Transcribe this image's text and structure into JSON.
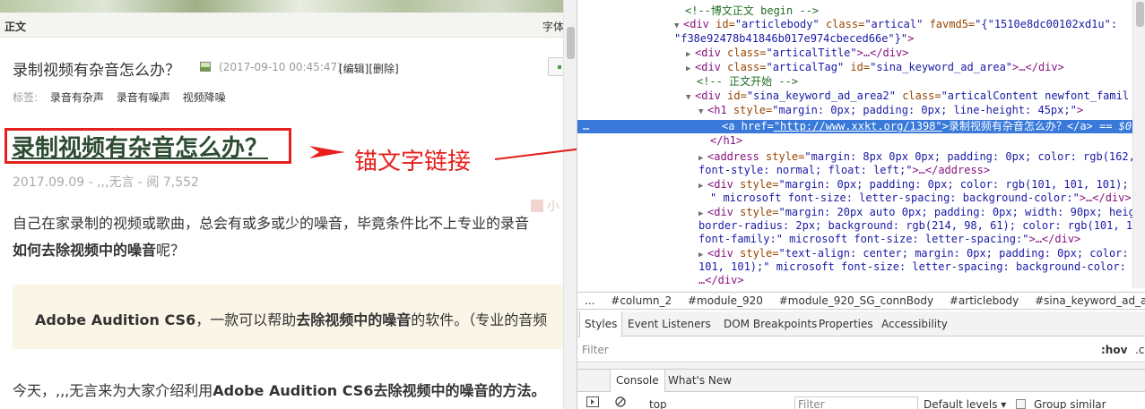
{
  "blog": {
    "section_title": "正文",
    "font_size_label": "字体",
    "post_title": "录制视频有杂音怎么办？",
    "post_date": "(2017-09-10 00:45:47)",
    "edit_links": "[编辑][删除]",
    "tags_label": "标签:",
    "tags": [
      "录音有杂声",
      "录音有噪声",
      "视频降噪"
    ],
    "article_title": "录制视频有杂音怎么办？",
    "annotation": "锚文字链接",
    "meta": "2017.09.09 - ,,,无言 - 阅 7,552",
    "watermark": "小小课堂",
    "para1_line1": "自己在家录制的视频或歌曲，总会有或多或少的噪音，毕竟条件比不上专业的录音",
    "para1_bold": "如何去除视频中的噪音",
    "para1_tail": "呢？",
    "quote_bold1": "Adobe Audition CS6",
    "quote_mid": "，一款可以帮助",
    "quote_bold2": "去除视频中的噪音",
    "quote_tail": "的软件。（专业的音频",
    "para2_start": "今天，,,,无言来为大家介绍利用",
    "para2_bold": "Adobe Audition CS6去除视频中的噪音的方法。"
  },
  "devtools": {
    "lines": [
      {
        "text": "<!--博文正文 begin -->"
      },
      {
        "tag_open": "<div",
        "a1": " id=",
        "v1": "\"articlebody\"",
        "a2": " class=",
        "v2": "\"artical\"",
        "a3": " favmd5=",
        "v3": "\"{\"1510e8dc00102xd1u\":"
      },
      {
        "v_cont": "\"f38e92478b41846b017e974cbeced66e\"}\"",
        "close": ">"
      },
      {
        "tag_open": "<div",
        "a1": " class=",
        "v1": "\"articalTitle\"",
        "rest": ">…</div>"
      },
      {
        "tag_open": "<div",
        "a1": " class=",
        "v1": "\"articalTag\"",
        "a2": " id=",
        "v2": "\"sina_keyword_ad_area\"",
        "rest": ">…</div>"
      },
      {
        "text": "<!-- 正文开始 -->"
      },
      {
        "tag_open": "<div",
        "a1": " id=",
        "v1": "\"sina_keyword_ad_area2\"",
        "a2": " class=",
        "v2": "\"articalContent   newfont_famil"
      },
      {
        "tag_open": "<h1",
        "a1": " style=",
        "v1": "\"margin: 0px; padding: 0px; line-height: 45px;\"",
        "rest": ">"
      },
      {
        "tag_open": "<a",
        "a1": " href=",
        "v1": "\"http://www.xxkt.org/1398\"",
        "inner": ">录制视频有杂音怎么办？</a>",
        "suffix": " == $0"
      },
      {
        "rest": "</h1>"
      },
      {
        "tag_open": "<address",
        "a1": " style=",
        "v1": "\"margin: 8px 0px 0px; padding: 0px; color: rgb(162,"
      },
      {
        "v_cont": "font-style: normal; float: left;\"",
        "rest": ">…</address>"
      },
      {
        "tag_open": "<div",
        "a1": " style=",
        "v1": "\"margin: 0px; padding: 0px; color: rgb(101, 101, 101); f"
      },
      {
        "v_cont": "\" microsoft font-size: letter-spacing: background-color:\"",
        "rest": ">…</div>"
      },
      {
        "tag_open": "<div",
        "a1": " style=",
        "v1": "\"margin: 20px auto 0px; padding: 0px; width: 90px; heigh"
      },
      {
        "v_cont": "border-radius: 2px; background: rgb(214, 98, 61); color: rgb(101, 101"
      },
      {
        "v_cont": "font-family:\" microsoft font-size: letter-spacing:\"",
        "rest": ">…</div>"
      },
      {
        "tag_open": "<div",
        "a1": " style=",
        "v1": "\"text-align: center; margin: 0px; padding: 0px; color: r"
      },
      {
        "v_cont": "101, 101);\" microsoft font-size: letter-spacing: background-color: te"
      },
      {
        "rest": "…</div>"
      }
    ],
    "breadcrumbs": [
      "...",
      "#column_2",
      "#module_920",
      "#module_920_SG_connBody",
      "#articlebody",
      "#sina_keyword_ad_area2"
    ],
    "subtabs": [
      "Styles",
      "Event Listeners",
      "DOM Breakpoints",
      "Properties",
      "Accessibility"
    ],
    "filter_placeholder": "Filter",
    "hov": ":hov",
    "cls": ".c",
    "drawer_tabs": [
      "Console",
      "What's New"
    ],
    "console_context": "top",
    "console_filter_placeholder": "Filter",
    "default_levels": "Default levels ▾",
    "group_similar": "Group similar"
  }
}
